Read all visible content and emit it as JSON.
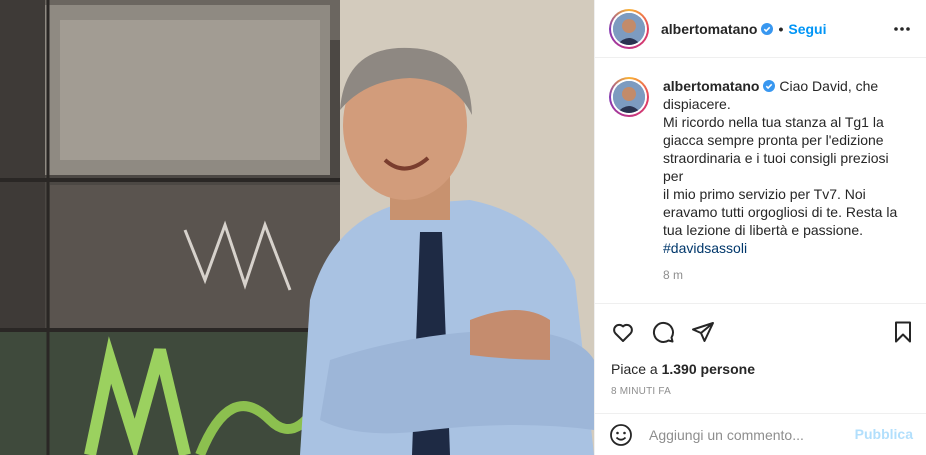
{
  "post": {
    "username": "albertomatano",
    "follow_label": "Segui",
    "follow_separator": "•",
    "caption_lines": [
      "Ciao David, che",
      "dispiacere.",
      "Mi ricordo nella tua stanza al Tg1 la",
      "giacca sempre pronta per l'edizione",
      "straordinaria e i tuoi consigli preziosi per",
      "il mio primo servizio per Tv7. Noi",
      "eravamo tutti orgogliosi di te. Resta la",
      "tua lezione di libertà e passione."
    ],
    "hashtag": "#davidsassoli",
    "caption_time": "8 m",
    "likes_prefix": "Piace a ",
    "likes_count": "1.390 persone",
    "posted_ago": "8 MINUTI FA",
    "comment_placeholder": "Aggiungi un commento...",
    "publish_label": "Pubblica"
  },
  "icons": [
    "verified-badge-icon",
    "more-options-icon",
    "heart-icon",
    "comment-icon",
    "share-icon",
    "bookmark-icon",
    "emoji-icon"
  ],
  "colors": {
    "link_blue": "#0095f6",
    "publish_disabled": "#b2dffc",
    "hashtag": "#00376b",
    "muted": "#8e8e8e"
  }
}
